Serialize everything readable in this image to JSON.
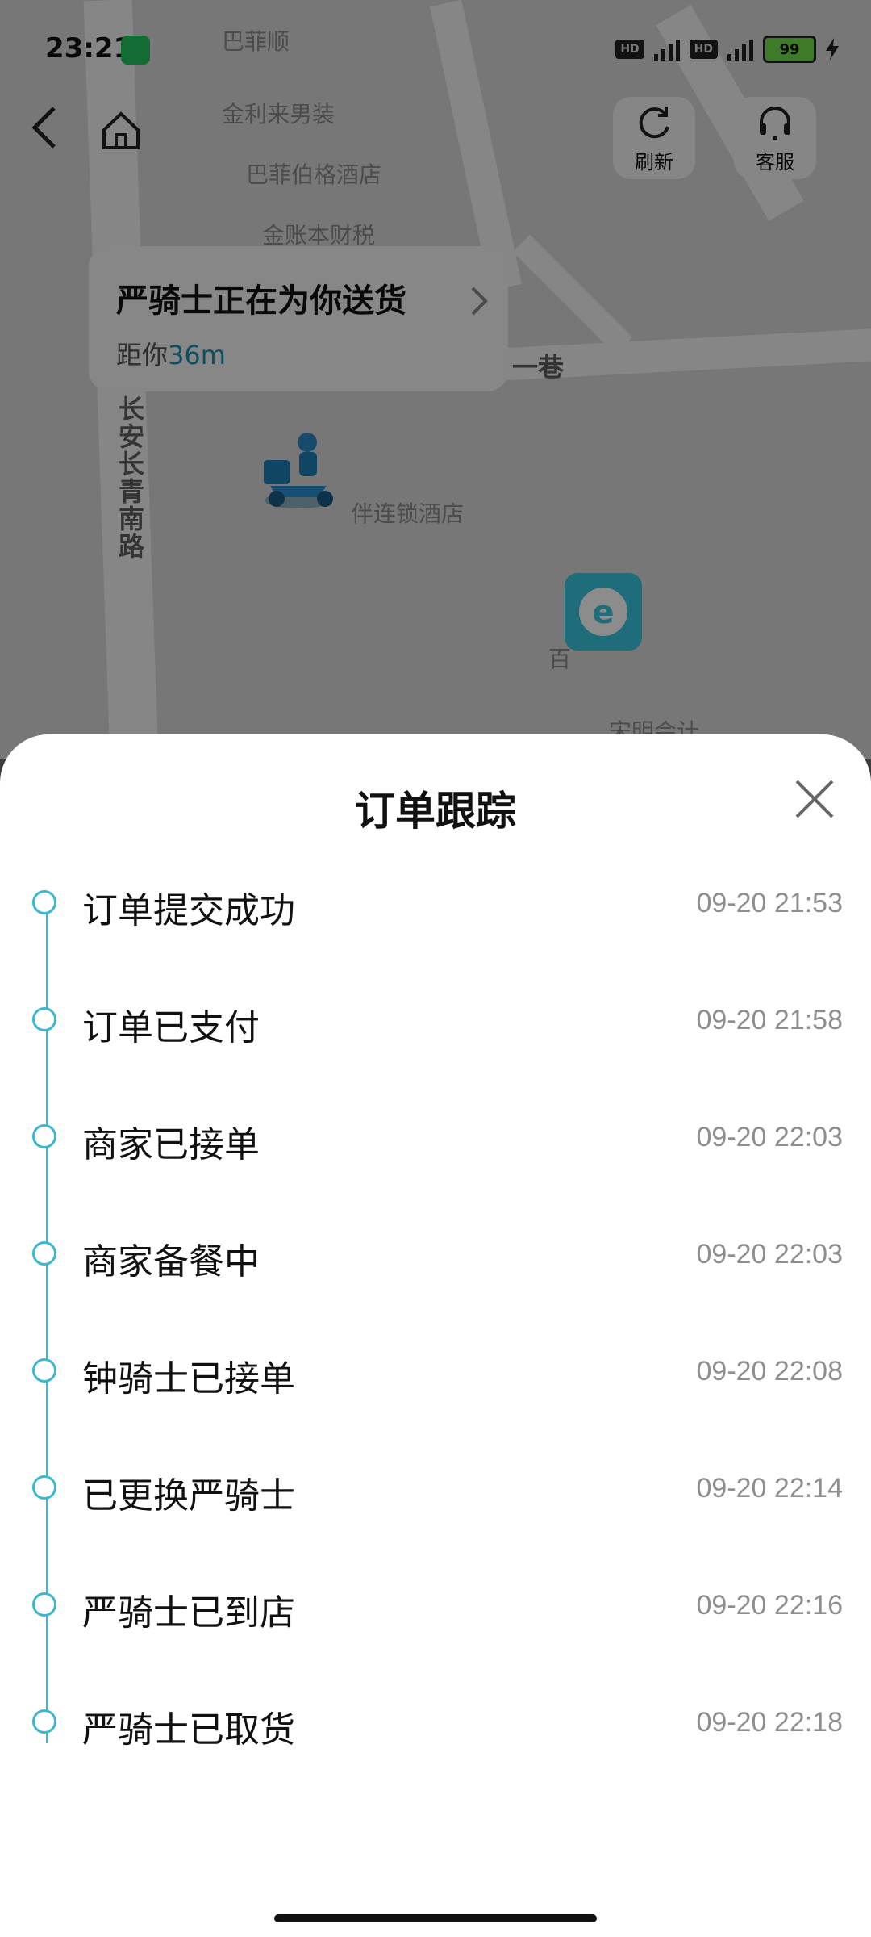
{
  "status_bar": {
    "time": "23:21",
    "battery": "99"
  },
  "map": {
    "labels": [
      "巴菲顺",
      "金利来男装",
      "巴菲伯格酒店",
      "金账本财税",
      "一巷",
      "长安长青南路",
      "伴连锁酒店",
      "百",
      "宋明会计"
    ]
  },
  "top_buttons": {
    "refresh_label": "刷新",
    "service_label": "客服"
  },
  "rider_card": {
    "title": "严骑士正在为你送货",
    "distance_prefix": "距你",
    "distance_value": "36m"
  },
  "sheet": {
    "title": "订单跟踪",
    "events": [
      {
        "label": "订单提交成功",
        "time": "09-20 21:53"
      },
      {
        "label": "订单已支付",
        "time": "09-20 21:58"
      },
      {
        "label": "商家已接单",
        "time": "09-20 22:03"
      },
      {
        "label": "商家备餐中",
        "time": "09-20 22:03"
      },
      {
        "label": "钟骑士已接单",
        "time": "09-20 22:08"
      },
      {
        "label": "已更换严骑士",
        "time": "09-20 22:14"
      },
      {
        "label": "严骑士已到店",
        "time": "09-20 22:16"
      },
      {
        "label": "严骑士已取货",
        "time": "09-20 22:18"
      }
    ]
  },
  "colors": {
    "accent": "#3bb8cf",
    "distance": "#1893b6"
  }
}
